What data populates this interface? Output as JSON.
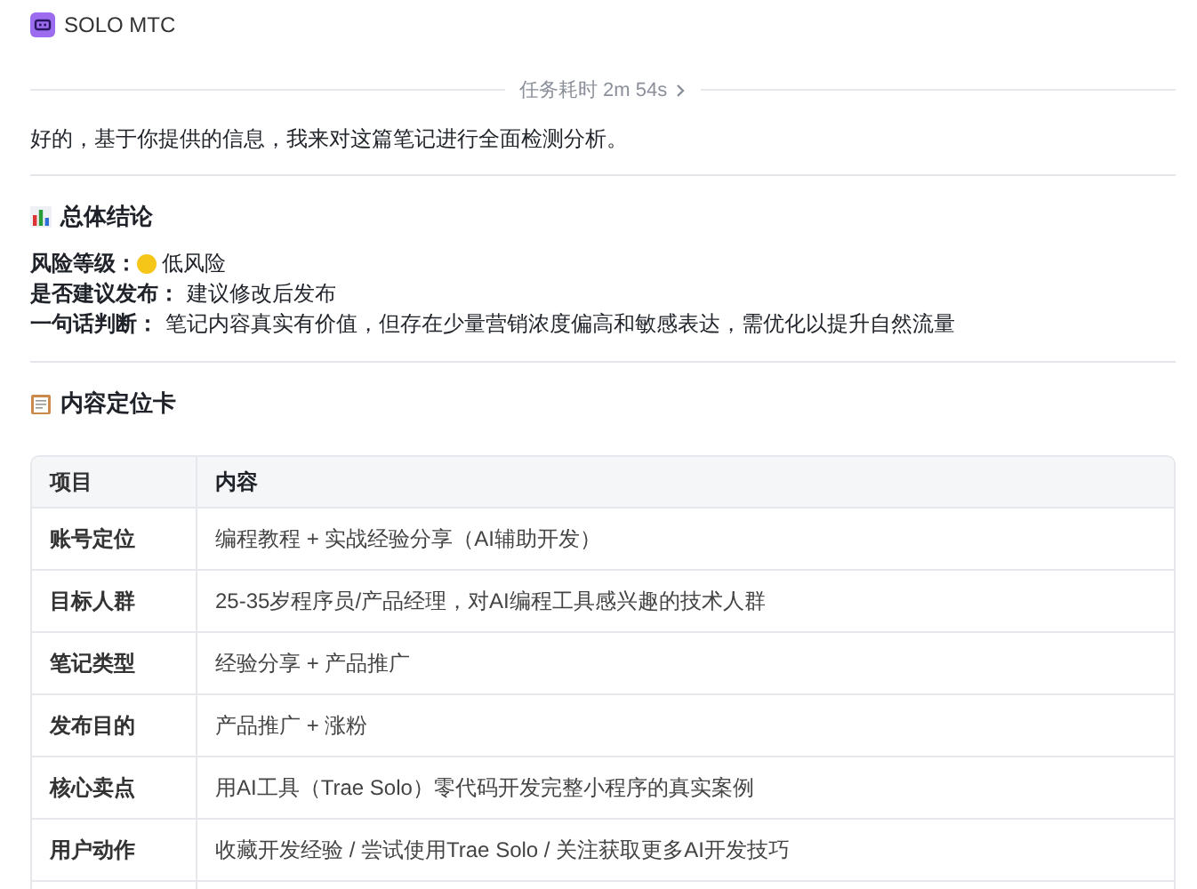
{
  "header": {
    "title": "SOLO MTC"
  },
  "task_time": "任务耗时 2m 54s",
  "intro": "好的，基于你提供的信息，我来对这篇笔记进行全面检测分析。",
  "summary": {
    "heading": "总体结论",
    "fields": [
      {
        "label": "风险等级：",
        "value": "低风险",
        "kind": "risk"
      },
      {
        "label": "是否建议发布：",
        "value": "建议修改后发布",
        "kind": "text"
      },
      {
        "label": "一句话判断：",
        "value": "笔记内容真实有价值，但存在少量营销浓度偏高和敏感表达，需优化以提升自然流量",
        "kind": "text"
      }
    ]
  },
  "card": {
    "heading": "内容定位卡",
    "table": {
      "columns": [
        "项目",
        "内容"
      ],
      "rows": [
        [
          "账号定位",
          "编程教程 + 实战经验分享（AI辅助开发）"
        ],
        [
          "目标人群",
          "25-35岁程序员/产品经理，对AI编程工具感兴趣的技术人群"
        ],
        [
          "笔记类型",
          "经验分享 + 产品推广"
        ],
        [
          "发布目的",
          "产品推广 + 涨粉"
        ],
        [
          "核心卖点",
          "用AI工具（Trae Solo）零代码开发完整小程序的真实案例"
        ],
        [
          "用户动作",
          "收藏开发经验 / 尝试使用Trae Solo / 关注获取更多AI开发技巧"
        ]
      ]
    }
  }
}
